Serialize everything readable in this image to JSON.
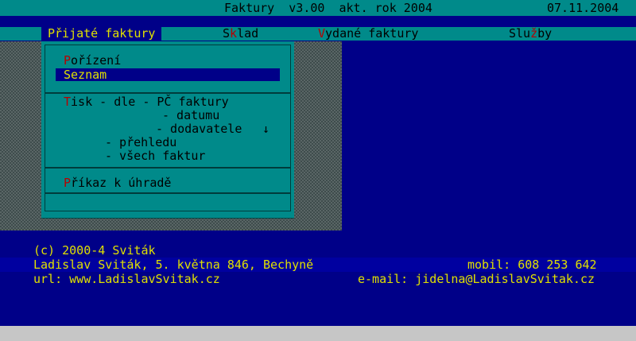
{
  "window": {
    "title": "Faktury  v3.00  akt. rok 2004",
    "date": "07.11.2004"
  },
  "menubar": {
    "items": [
      {
        "hot": "P",
        "rest": "řijaté faktury"
      },
      {
        "pre": "S",
        "hot": "k",
        "rest": "lad"
      },
      {
        "hot": "V",
        "rest": "ydané faktury"
      },
      {
        "pre": "Slu",
        "hot": "ž",
        "rest": "by"
      }
    ]
  },
  "dropdown": {
    "porizeni": {
      "hot": "P",
      "rest": "ořízení"
    },
    "seznam": "Seznam",
    "tisk": {
      "line1_hot": "T",
      "line1_rest": "isk - dle - PČ faktury",
      "line2": "- datumu",
      "line3": "- dodavatele",
      "arrow": "↓",
      "line4": "- přehledu",
      "line5": "- všech faktur"
    },
    "prikaz": {
      "hot": "P",
      "rest": "říkaz k úhradě"
    }
  },
  "footer": {
    "copyright": "(c) 2000-4 Sviták",
    "address": "Ladislav Sviták, 5. května 846, Bechyně",
    "mobile": "mobil: 608 253 642",
    "url": "url: www.LadislavSvitak.cz",
    "email": "e-mail: jidelna@LadislavSvitak.cz"
  },
  "colors": {
    "background": "#000088",
    "bar": "#008a8a",
    "highlight": "#e0e000",
    "hotkey": "#b80000"
  }
}
